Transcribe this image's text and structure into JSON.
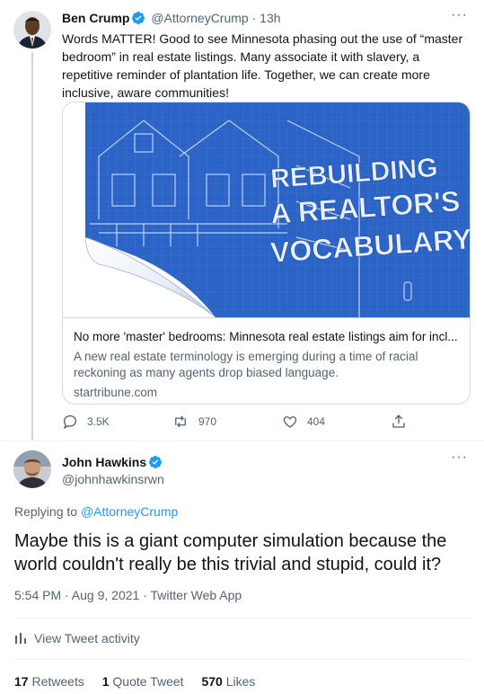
{
  "tweet1": {
    "author_name": "Ben Crump",
    "author_handle": "@AttorneyCrump",
    "time_ago": "13h",
    "text": "Words MATTER! Good to see Minnesota phasing out the use of “master bedroom” in real estate listings. Many associate it with slavery, a repetitive reminder of plantation life. Together, we can create more inclusive, aware communities!",
    "card": {
      "image_text": [
        "REBUILDING",
        "A REALTOR'S",
        "VOCABULARY"
      ],
      "title": "No more 'master' bedrooms: Minnesota real estate listings aim for incl...",
      "description": "A new real estate terminology is emerging during a time of racial reckoning as many agents drop biased language.",
      "domain": "startribune.com"
    },
    "actions": {
      "replies": "3.5K",
      "retweets": "970",
      "likes": "404"
    },
    "icons": [
      "verified-badge-icon",
      "more-icon",
      "reply-icon",
      "retweet-icon",
      "like-icon",
      "share-icon"
    ]
  },
  "tweet2": {
    "author_name": "John Hawkins",
    "author_handle": "@johnhawkinsrwn",
    "replying_prefix": "Replying to",
    "replying_handle": "@AttorneyCrump",
    "text": "Maybe this is a giant computer simulation because the world couldn't really be this trivial and stupid, could it?",
    "timestamp": "5:54 PM · Aug 9, 2021 · Twitter Web App",
    "activity_label": "View Tweet activity",
    "stats": {
      "retweets_count": "17",
      "retweets_label": "Retweets",
      "quotes_count": "1",
      "quotes_label": "Quote Tweet",
      "likes_count": "570",
      "likes_label": "Likes"
    }
  },
  "colors": {
    "accent": "#1d9bf0",
    "text_primary": "#0f1419",
    "text_secondary": "#536471",
    "border": "#cfd9de",
    "blueprint": "#2b63c6"
  }
}
